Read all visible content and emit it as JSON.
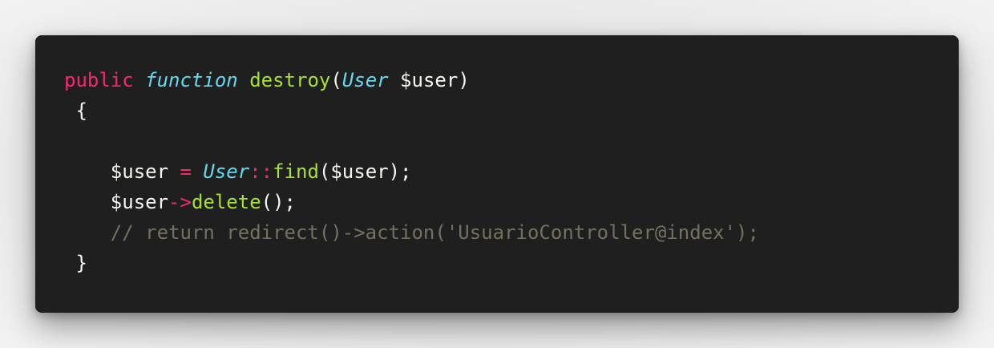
{
  "code": {
    "line1": {
      "public": "public",
      "function": "function",
      "name": "destroy",
      "open_paren": "(",
      "type": "User",
      "param": " $user",
      "close_paren": ")"
    },
    "line2": {
      "brace": " {"
    },
    "line4": {
      "indent": "    ",
      "var": "$user",
      "assign": " = ",
      "class": "User",
      "scope": "::",
      "method": "find",
      "args": "($user);"
    },
    "line5": {
      "indent": "    ",
      "var": "$user",
      "arrow": "->",
      "method": "delete",
      "args": "();"
    },
    "line6": {
      "indent": "    ",
      "comment": "// return redirect()->action('UsuarioController@index');"
    },
    "line7": {
      "brace": " }"
    }
  },
  "colors": {
    "background": "#1f1f1f",
    "keyword": "#f92672",
    "function_keyword": "#66d9ef",
    "function_name": "#a6e22e",
    "text": "#f8f8f2",
    "comment": "#75715e"
  }
}
